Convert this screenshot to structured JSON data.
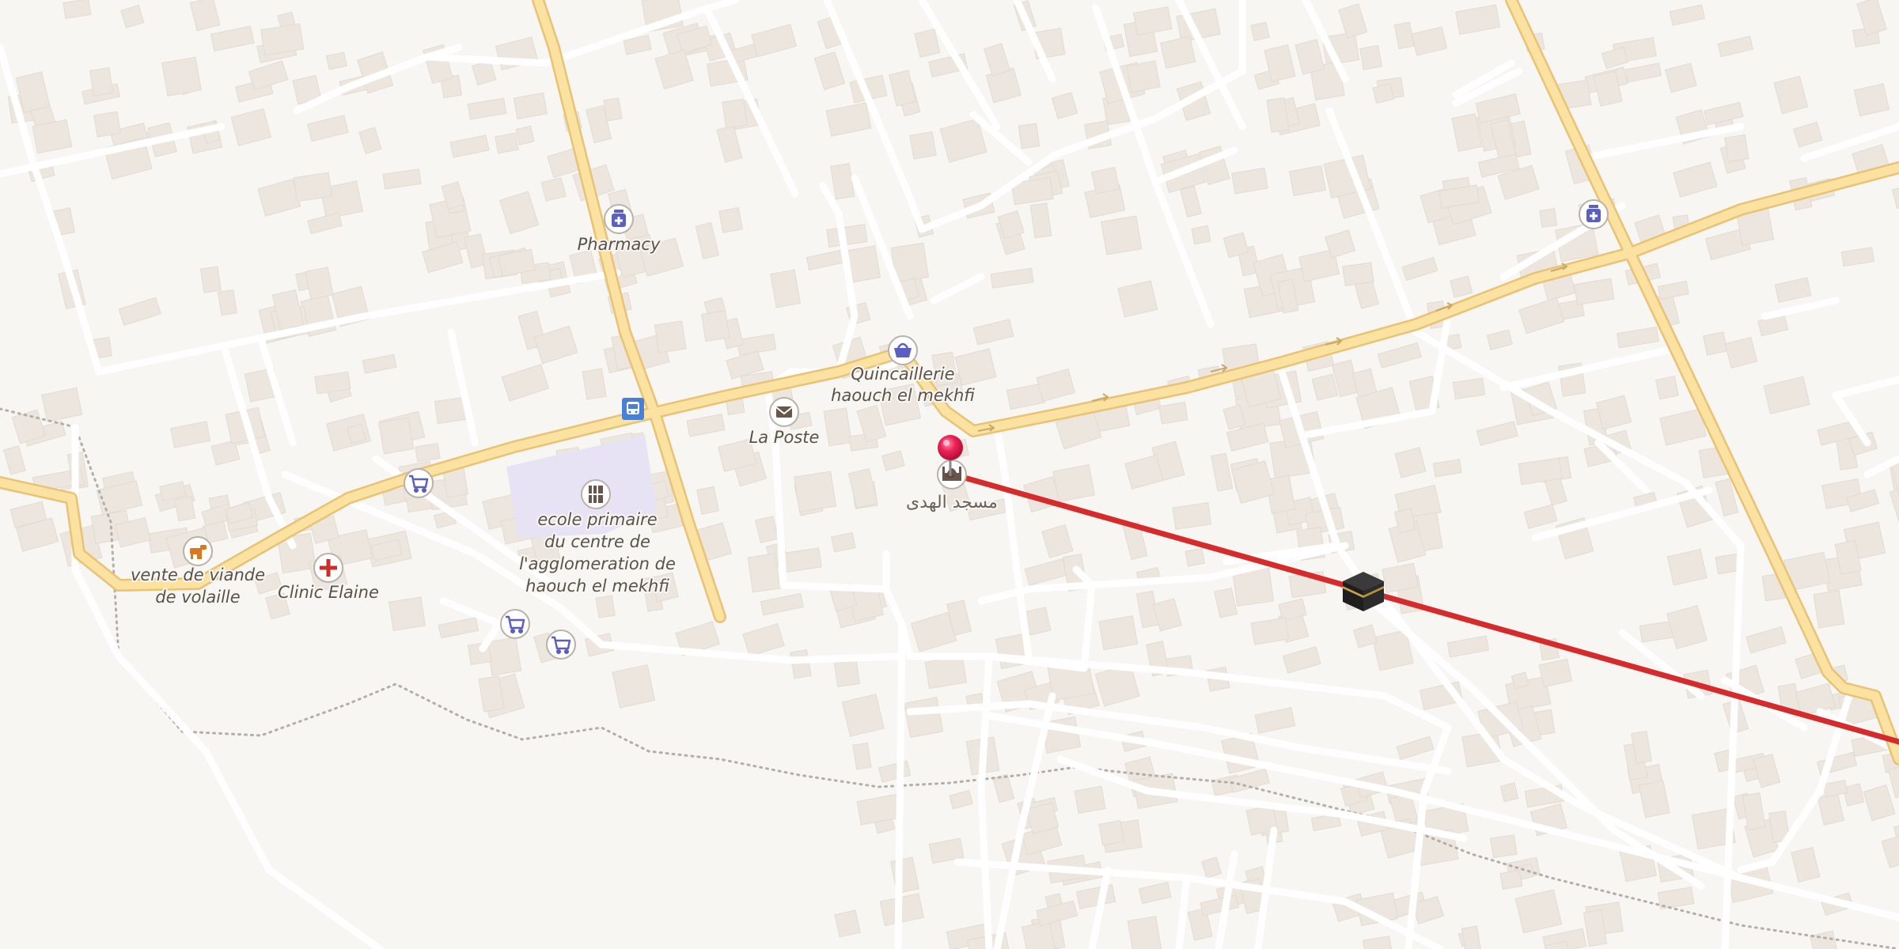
{
  "map": {
    "labels": {
      "pharmacy": "Pharmacy",
      "quincaillerie_l1": "Quincaillerie",
      "quincaillerie_l2": "haouch el mekhfi",
      "la_poste": "La Poste",
      "mosque": "مسجد الهدى",
      "ecole_l1": "ecole primaire",
      "ecole_l2": "du centre de",
      "ecole_l3": "l'agglomeration de",
      "ecole_l4": "haouch el mekhfi",
      "vente_l1": "vente de viande",
      "vente_l2": "de volaille",
      "clinic": "Clinic Elaine"
    },
    "colors": {
      "background": "#f8f6f3",
      "building": "#ece6df",
      "minor_road": "#ffffff",
      "major_road": "#fbe2a0",
      "major_road_casing": "#e8c276",
      "school_area": "#e7e3f4",
      "boundary": "#b5aea7",
      "qibla_line": "#d52b2b",
      "pin": "#e8144a",
      "poi_icon": "#5b5fbf"
    },
    "icons": {
      "pharmacy": "pharmacy-icon",
      "shop": "shopping-basket-icon",
      "post": "envelope-icon",
      "mosque": "mosque-icon",
      "school": "school-icon",
      "bus": "bus-stop-icon",
      "supermarket": "shopping-cart-icon",
      "butcher": "cow-icon",
      "clinic": "medical-cross-icon",
      "kaaba": "kaaba-icon",
      "pin": "location-pin-icon"
    }
  }
}
